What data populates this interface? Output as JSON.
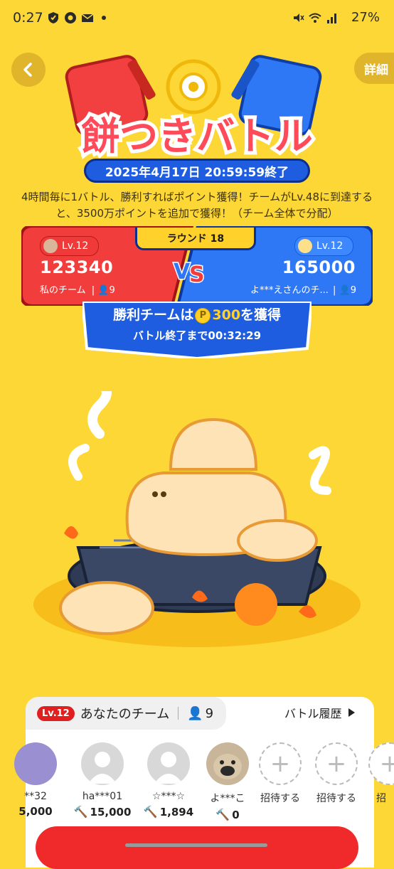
{
  "status_bar": {
    "time": "0:27",
    "battery": "27%"
  },
  "header": {
    "back_icon": "chevron-left-icon",
    "detail_label": "詳細"
  },
  "event": {
    "logo_title": "餅つきバトル",
    "end_date": "2025年4月17日 20:59:59終了",
    "description": "4時間毎に1バトル、勝利すればポイント獲得！チームがLv.48に到達すると、3500万ポイントを追加で獲得！（チーム全体で分配）"
  },
  "battle": {
    "round_label": "ラウンド 18",
    "red_team": {
      "level": "Lv.12",
      "score": "123340",
      "name": "私のチーム",
      "members": "9"
    },
    "blue_team": {
      "level": "Lv.12",
      "score": "165000",
      "name": "よ***えさんのチ...",
      "members": "9"
    },
    "vs_label": "VS",
    "reward_prefix": "勝利チームは",
    "reward_points": "300",
    "reward_suffix": "を獲得",
    "coin_letter": "P",
    "countdown": "バトル終了まで00:32:29"
  },
  "team_panel": {
    "level_tag": "Lv.12",
    "title": "あなたのチーム",
    "member_count": "9",
    "history_label": "バトル履歴",
    "members": [
      {
        "name": "**32",
        "score": "5,000"
      },
      {
        "name": "ha***01",
        "score": "15,000"
      },
      {
        "name": "☆***☆",
        "score": "1,894"
      },
      {
        "name": "よ***こ",
        "score": "0"
      },
      {
        "name": "招待する",
        "score": ""
      },
      {
        "name": "招待する",
        "score": ""
      },
      {
        "name": "招",
        "score": ""
      }
    ]
  },
  "colors": {
    "background": "#fdd735",
    "red_team": "#f03a3a",
    "blue_team": "#2f78f5",
    "accent_blue": "#1e5ce0"
  }
}
